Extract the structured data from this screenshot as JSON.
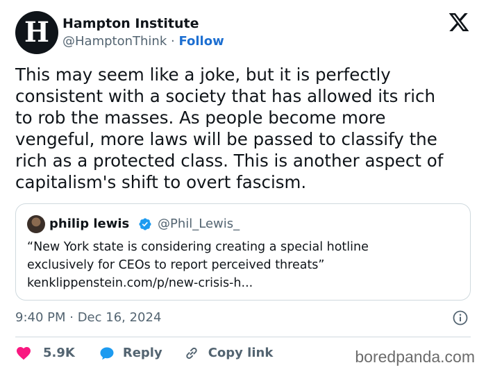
{
  "author": {
    "avatar_letter": "H",
    "name": "Hampton Institute",
    "handle": "@HamptonThink",
    "separator": "·",
    "follow_label": "Follow"
  },
  "tweet": {
    "lines": [
      "This may seem like a joke, but it is perfectly",
      "consistent with a society that has allowed its rich",
      "to rob the masses. As people become more",
      "vengeful, more laws will be passed to classify the",
      "rich as a protected class. This is another aspect of",
      "capitalism's shift to overt fascism."
    ]
  },
  "quoted_tweet": {
    "name": "philip lewis",
    "handle": "@Phil_Lewis_",
    "verified": true,
    "lines": [
      "“New York state is considering creating a special hotline",
      "exclusively for CEOs to report perceived threats”",
      "kenklippenstein.com/p/new-crisis-h..."
    ]
  },
  "timestamp": "9:40 PM · Dec 16, 2024",
  "actions": {
    "likes": "5.9K",
    "reply_label": "Reply",
    "copy_label": "Copy link"
  },
  "watermark": "boredpanda.com",
  "colors": {
    "heart": "#f91880",
    "reply_icon": "#1d9bf0",
    "follow": "#1d6fd1",
    "verified": "#1d9bf0",
    "muted_text": "#536471"
  }
}
